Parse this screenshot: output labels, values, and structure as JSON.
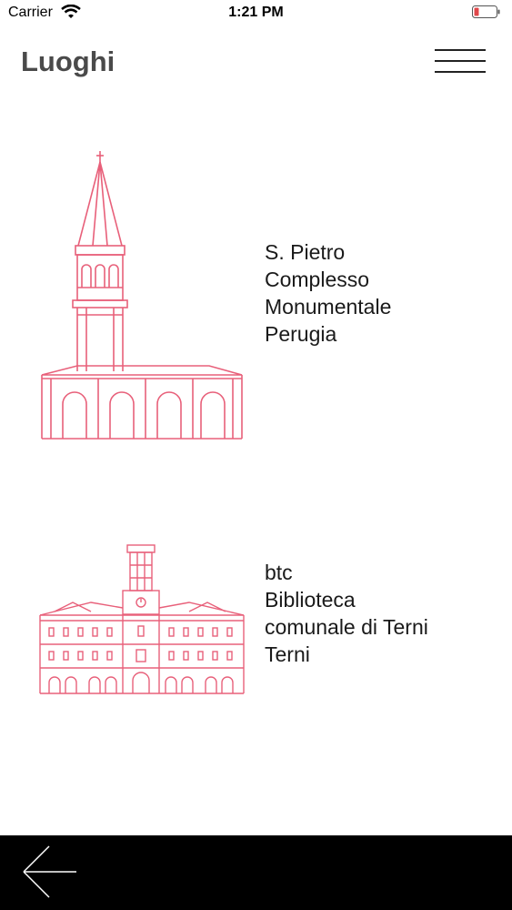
{
  "status_bar": {
    "carrier": "Carrier",
    "time": "1:21 PM",
    "wifi_icon": "wifi-icon",
    "battery_icon": "battery-low-icon",
    "battery_color": "#e0484b"
  },
  "header": {
    "title": "Luoghi",
    "menu_icon": "hamburger-menu-icon"
  },
  "places": [
    {
      "icon": "church-tower-illustration",
      "lines": [
        "S. Pietro",
        "Complesso",
        "Monumentale",
        "Perugia"
      ]
    },
    {
      "icon": "library-building-illustration",
      "lines": [
        "btc",
        "Biblioteca",
        "comunale di Terni",
        "Terni"
      ]
    }
  ],
  "bottom_bar": {
    "back_icon": "back-arrow-icon"
  },
  "colors": {
    "accent": "#e8607a",
    "title": "#4a4a4a",
    "bottom_bar": "#000000"
  }
}
